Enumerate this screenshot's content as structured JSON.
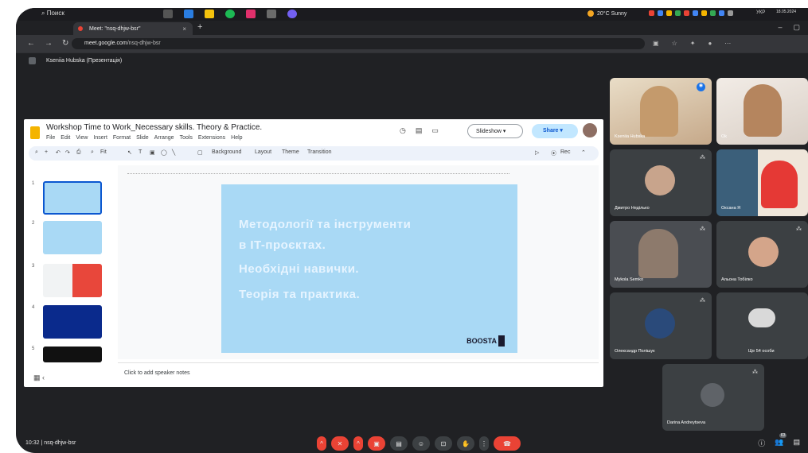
{
  "taskbar": {
    "search": "Поиск",
    "weather": "20°C Sunny",
    "lang": "УКР",
    "date": "18.05.2024"
  },
  "browser": {
    "tab_title": "Meet: \"nsq-dhjw-bsr\"",
    "tab_close": "×",
    "new_tab": "+",
    "url_host": "meet.google.com",
    "url_path": "/nsq-dhjw-bsr"
  },
  "presenter": {
    "label": "Kseniia Hubska (Презентація)"
  },
  "slides": {
    "doc_title": "Workshop Time to Work_Necessary skills. Theory & Practice.",
    "menu": [
      "File",
      "Edit",
      "View",
      "Insert",
      "Format",
      "Slide",
      "Arrange",
      "Tools",
      "Extensions",
      "Help"
    ],
    "slideshow_label": "Slideshow",
    "share_label": "Share",
    "toolbar": {
      "zoom": "Fit",
      "background": "Background",
      "layout": "Layout",
      "theme": "Theme",
      "transition": "Transition",
      "rec": "Rec"
    },
    "thumb_numbers": [
      "1",
      "2",
      "3",
      "4",
      "5"
    ],
    "slide_lines": [
      "Методології та інструменти",
      "в IT-проєктах.",
      "Необхідні навички.",
      "Теорія та практика."
    ],
    "slide_brand": "BOOSTA",
    "notes_placeholder": "Click to add speaker notes"
  },
  "participants": [
    {
      "name": "Kseniia Hubska"
    },
    {
      "name": "Ok"
    },
    {
      "name": "Дмитро Неділько"
    },
    {
      "name": "Оксана Я"
    },
    {
      "name": "Mykola Semko"
    },
    {
      "name": "Альона Тобілко"
    },
    {
      "name": "Олександр Полішук"
    },
    {
      "name": "Ще 54 особи"
    },
    {
      "name": "Darina Andreytseva"
    }
  ],
  "meet": {
    "time_code": "10:32 | nsq-dhjw-bsr",
    "people_count": "63"
  }
}
